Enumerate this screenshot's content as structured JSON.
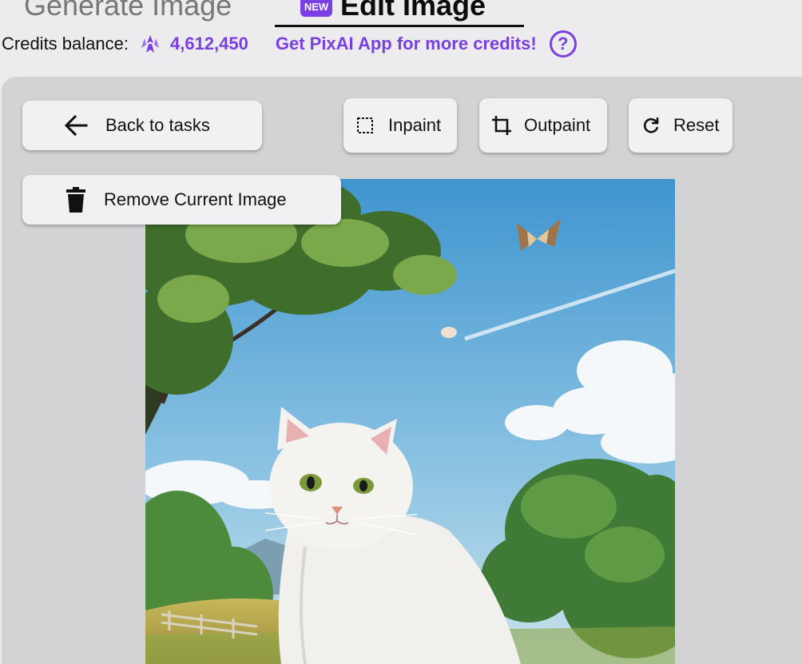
{
  "tabs": {
    "generate_label": "Generate Image",
    "edit_label": "Edit Image",
    "new_badge": "NEW"
  },
  "credits": {
    "label": "Credits balance:",
    "value": "4,612,450",
    "get_app_link": "Get PixAI App for more credits!",
    "help_glyph": "?"
  },
  "toolbar": {
    "back_label": "Back to tasks",
    "inpaint_label": "Inpaint",
    "outpaint_label": "Outpaint",
    "reset_label": "Reset",
    "remove_label": "Remove Current Image"
  },
  "icons": {
    "back": "arrow-left-icon",
    "inpaint": "dashed-selection-icon",
    "outpaint": "crop-icon",
    "reset": "refresh-icon",
    "remove": "trash-icon",
    "credits": "credits-coin-icon",
    "help": "help-icon"
  },
  "colors": {
    "accent": "#7a3fe0",
    "background": "#ececee",
    "panel": "#d3d3d6",
    "button": "#f1f1f3"
  }
}
